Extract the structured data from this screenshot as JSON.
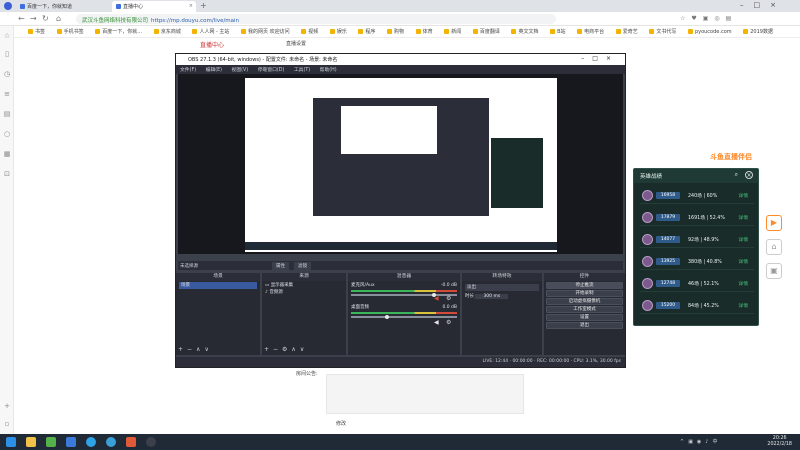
{
  "browser": {
    "tabs": [
      {
        "label": "百度一下，你就知道",
        "active": false
      },
      {
        "label": "武汉斗鱼网络科技有限公司",
        "active": false
      },
      {
        "label": "直播中心",
        "active": true
      }
    ],
    "url": {
      "site": "武汉斗鱼网络科技有限公司",
      "path": "https://mp.douyu.com/live/main"
    },
    "bookmarks": [
      "书签",
      "手机书签",
      "百度一下，你就…",
      "京东商城",
      "人人网 - 主站",
      "我的网页 欢迎访问",
      "视频",
      "娱乐",
      "程序",
      "购物",
      "体育",
      "新闻",
      "百度翻译",
      "英文文档",
      "B站",
      "电商平台",
      "爱奇艺",
      "文书代写",
      "pyoucode.com",
      "2019数据"
    ]
  },
  "page": {
    "header": "直播中心",
    "subheader": "直播设置",
    "announcement_label": "房间公告:",
    "modify_label": "修改"
  },
  "obs": {
    "title": "OBS 27.1.3 (64-bit, windows) - 配置文件: 未命名 - 场景: 未命名",
    "menu": [
      "文件(F)",
      "编辑(E)",
      "视图(V)",
      "停靠窗口(D)",
      "工具(T)",
      "帮助(H)"
    ],
    "no_source": "未选择源",
    "props_label": "属性",
    "filters_label": "滤镜",
    "docks": {
      "scenes": {
        "title": "场景",
        "items": [
          "场景"
        ]
      },
      "sources": {
        "title": "来源",
        "items": [
          "显示器采集",
          "音频源"
        ]
      },
      "mixer": {
        "title": "混音器",
        "channels": [
          {
            "name": "麦克风/Aux",
            "db": "-0.0 dB"
          },
          {
            "name": "桌面音频",
            "db": "0.0 dB"
          }
        ]
      },
      "transitions": {
        "title": "转场特效",
        "type": "淡出",
        "duration_label": "时长",
        "duration": "300 ms"
      },
      "controls": {
        "title": "控件",
        "buttons": [
          "停止推流",
          "开始录制",
          "启动虚拟摄像机",
          "工作室模式",
          "设置",
          "退出"
        ]
      }
    },
    "status": "LIVE: 12:44 · 00:00:00 · REC: 00:00:00 · CPU: 3.1%, 30.00 fps"
  },
  "ranking": {
    "banner": "斗鱼直播伴侣",
    "title": "英雄战绩",
    "players": [
      {
        "tag": "16958",
        "record": "240场 | 60%",
        "detail": "详情"
      },
      {
        "tag": "17879",
        "record": "1691场 | 52.4%",
        "detail": "详情"
      },
      {
        "tag": "14077",
        "record": "92场 | 48.9%",
        "detail": "详情"
      },
      {
        "tag": "13925",
        "record": "380场 | 40.8%",
        "detail": "详情"
      },
      {
        "tag": "12748",
        "record": "46场 | 52.1%",
        "detail": "详情"
      },
      {
        "tag": "15200",
        "record": "84场 | 45.2%",
        "detail": "详情"
      }
    ]
  },
  "taskbar": {
    "time": "20:26",
    "date": "2022/2/18"
  }
}
